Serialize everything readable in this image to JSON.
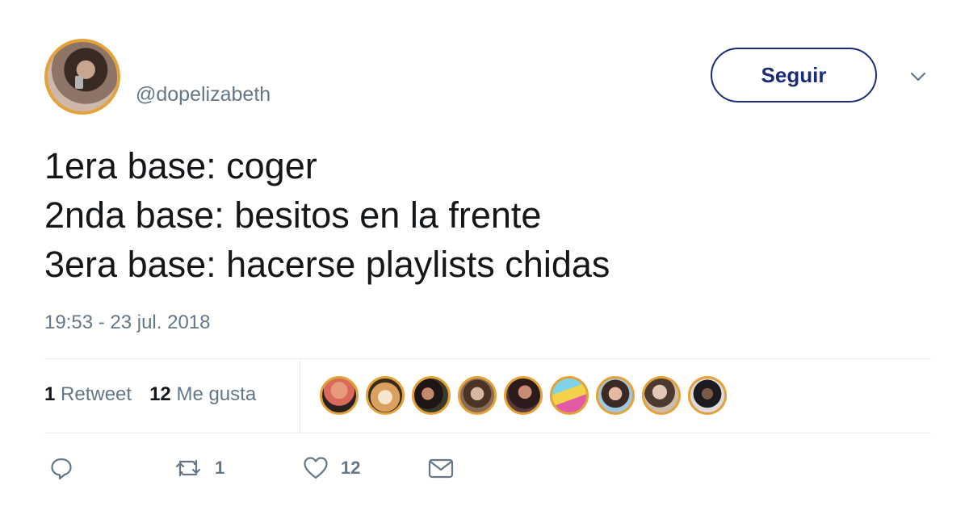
{
  "user": {
    "handle": "@dopelizabeth"
  },
  "follow_button": {
    "label": "Seguir"
  },
  "tweet": {
    "lines": [
      "1era base: coger",
      "2nda base: besitos en la frente",
      "3era base: hacerse playlists chidas"
    ],
    "timestamp": "19:53 - 23 jul. 2018"
  },
  "stats": {
    "retweets_count": "1",
    "retweets_label": "Retweet",
    "likes_count": "12",
    "likes_label": "Me gusta"
  },
  "likers_count": 9,
  "actions": {
    "reply_icon": "reply-icon",
    "retweet_icon": "retweet-icon",
    "retweet_count": "1",
    "like_icon": "heart-icon",
    "like_count": "12",
    "message_icon": "envelope-icon"
  },
  "colors": {
    "accent": "#1b2b7a",
    "muted": "#657786",
    "avatar_ring": "#e4a23a"
  }
}
